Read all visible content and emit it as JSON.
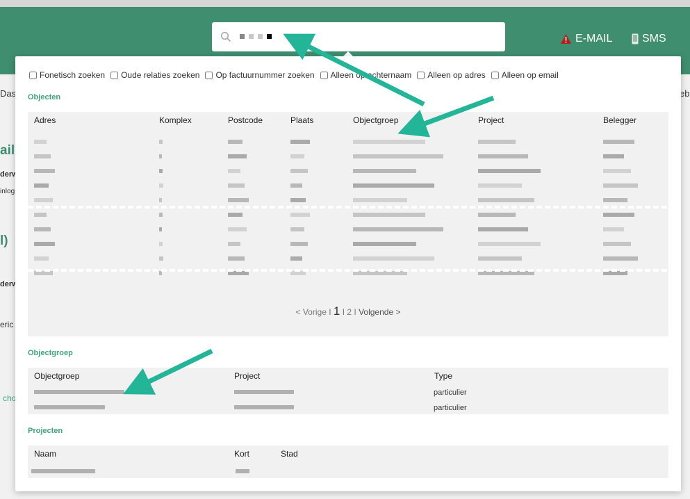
{
  "header": {
    "email_label": "E-MAIL",
    "sms_label": "SMS",
    "accent": "#3f8e6f"
  },
  "background": {
    "dash": "Dash",
    "ebr": "ebr",
    "ail": "ail",
    "derw1": "derw",
    "inlog": "inlog",
    "paren": "l)",
    "derw2": "derw",
    "eric": "eric",
    "cho": "cho"
  },
  "options": [
    {
      "label": "Fonetisch zoeken"
    },
    {
      "label": "Oude relaties zoeken"
    },
    {
      "label": "Op factuurnummer zoeken"
    },
    {
      "label": "Alleen op achternaam"
    },
    {
      "label": "Alleen op adres"
    },
    {
      "label": "Alleen op email"
    }
  ],
  "objecten": {
    "title": "Objecten",
    "headers": [
      "Adres",
      "Komplex",
      "Postcode",
      "Plaats",
      "Objectgroep",
      "Project",
      "Belegger"
    ],
    "row_count": 10
  },
  "pager": {
    "prev": "< Vorige",
    "sep1": "I",
    "current": "1",
    "sep2": "I 2 I",
    "next": "Volgende >"
  },
  "objectgroep": {
    "title": "Objectgroep",
    "headers": [
      "Objectgroep",
      "Project",
      "Type"
    ],
    "rows": [
      {
        "type": "particulier"
      },
      {
        "type": "particulier"
      }
    ]
  },
  "projecten": {
    "title": "Projecten",
    "headers": [
      "Naam",
      "Kort",
      "Stad"
    ]
  }
}
